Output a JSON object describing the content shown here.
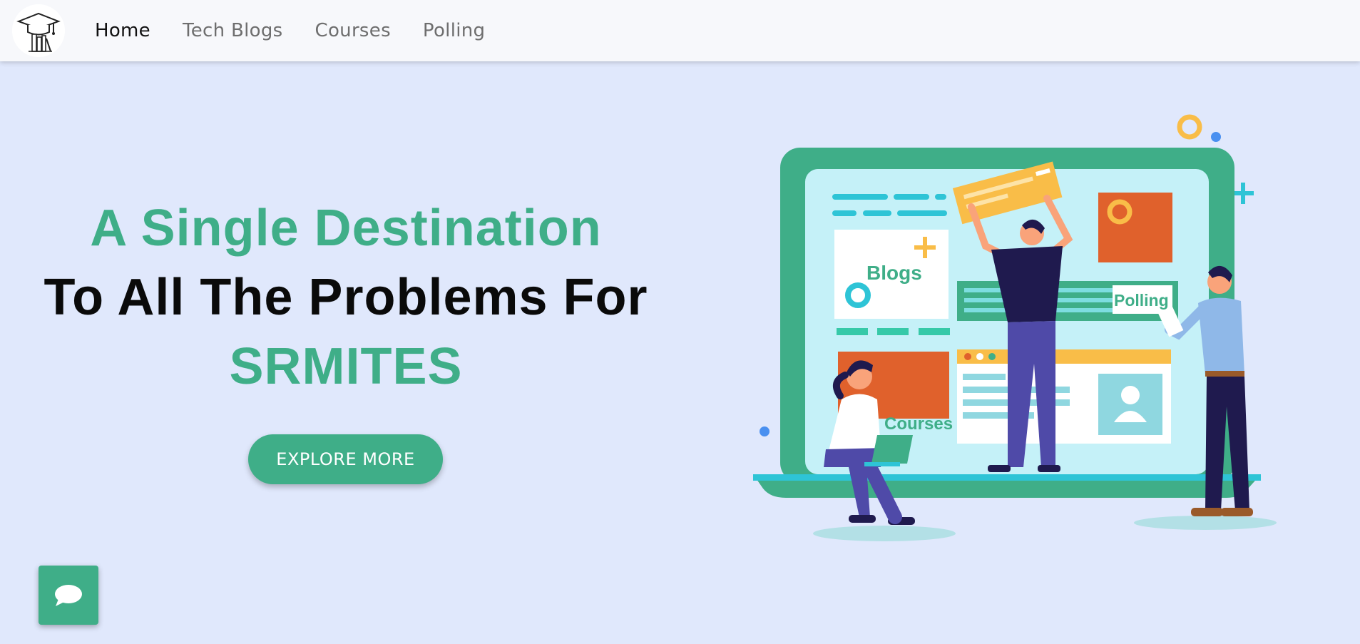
{
  "nav": {
    "links": [
      {
        "label": "Home",
        "active": true
      },
      {
        "label": "Tech Blogs",
        "active": false
      },
      {
        "label": "Courses",
        "active": false
      },
      {
        "label": "Polling",
        "active": false
      }
    ]
  },
  "hero": {
    "line1": "A Single Destination",
    "line2": "To All The Problems For",
    "line3": "SRMITES",
    "cta_label": "EXPLORE MORE"
  },
  "illustration": {
    "blogs_label": "Blogs",
    "polling_label": "Polling",
    "courses_label": "Courses"
  },
  "chat": {
    "icon": "chat-bubble-icon"
  },
  "colors": {
    "accent": "#3fae88",
    "background": "#e0e8fc",
    "navbar": "#f7f8fb",
    "orange": "#e0612c",
    "yellow": "#f9bd48",
    "navy": "#1f1a4e",
    "screen": "#c5f1f8"
  }
}
